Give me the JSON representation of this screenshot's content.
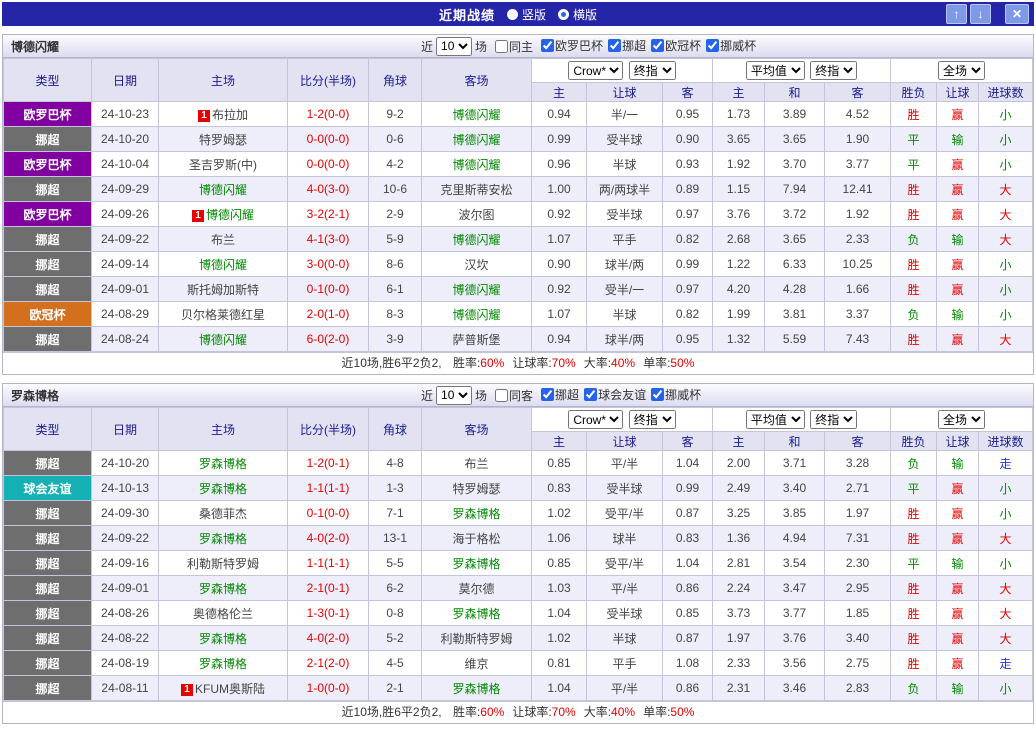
{
  "colors": {
    "red": "#e60000",
    "green": "#008800",
    "blue": "#2233cc",
    "score": "#e60000",
    "subject_team": "#008800",
    "league": {
      "欧罗巴杯": "#8000a0",
      "挪超": "#6e6e6e",
      "欧冠杯": "#d2701e",
      "球会友谊": "#14b0b4"
    }
  },
  "result_colors": {
    "胜": "red",
    "平": "green",
    "负": "green",
    "赢": "red",
    "输": "green",
    "走": "blue",
    "大": "red",
    "小": "green"
  },
  "title_bar": {
    "title": "近期战绩",
    "radios": [
      {
        "label": "竖版",
        "selected": false
      },
      {
        "label": "横版",
        "selected": true
      }
    ],
    "buttons": {
      "up": "↑",
      "down": "↓",
      "close": "✕"
    }
  },
  "table_header": {
    "type": "类型",
    "date": "日期",
    "home": "主场",
    "score": "比分(半场)",
    "corner": "角球",
    "away": "客场",
    "asia_selects": [
      "Crow*",
      "终指"
    ],
    "europe_selects": [
      "平均值",
      "终指"
    ],
    "result_select": "全场",
    "asia_sub": [
      "主",
      "让球",
      "客"
    ],
    "europe_sub": [
      "主",
      "和",
      "客"
    ],
    "result_sub": [
      "胜负",
      "让球",
      "进球数"
    ]
  },
  "sections": [
    {
      "team": "博德闪耀",
      "filter": {
        "near": "近",
        "count": "10",
        "games": "场",
        "same": "同主",
        "same_checked": false,
        "leagues": [
          {
            "label": "欧罗巴杯",
            "checked": true
          },
          {
            "label": "挪超",
            "checked": true
          },
          {
            "label": "欧冠杯",
            "checked": true
          },
          {
            "label": "挪威杯",
            "checked": true
          }
        ]
      },
      "rows": [
        {
          "league": "欧罗巴杯",
          "date": "24-10-23",
          "home": "布拉加",
          "home_badge": "1",
          "score": "1-2(0-0)",
          "corner": "9-2",
          "away": "博德闪耀",
          "asia": [
            "0.94",
            "半/一",
            "0.95"
          ],
          "europe": [
            "1.73",
            "3.89",
            "4.52"
          ],
          "results": [
            "胜",
            "赢",
            "小"
          ]
        },
        {
          "league": "挪超",
          "date": "24-10-20",
          "home": "特罗姆瑟",
          "score": "0-0(0-0)",
          "corner": "0-6",
          "away": "博德闪耀",
          "asia": [
            "0.99",
            "受半球",
            "0.90"
          ],
          "europe": [
            "3.65",
            "3.65",
            "1.90"
          ],
          "results": [
            "平",
            "输",
            "小"
          ]
        },
        {
          "league": "欧罗巴杯",
          "date": "24-10-04",
          "home": "圣吉罗斯(中)",
          "score": "0-0(0-0)",
          "corner": "4-2",
          "away": "博德闪耀",
          "asia": [
            "0.96",
            "半球",
            "0.93"
          ],
          "europe": [
            "1.92",
            "3.70",
            "3.77"
          ],
          "results": [
            "平",
            "赢",
            "小"
          ]
        },
        {
          "league": "挪超",
          "date": "24-09-29",
          "home": "博德闪耀",
          "score": "4-0(3-0)",
          "corner": "10-6",
          "away": "克里斯蒂安松",
          "asia": [
            "1.00",
            "两/两球半",
            "0.89"
          ],
          "europe": [
            "1.15",
            "7.94",
            "12.41"
          ],
          "results": [
            "胜",
            "赢",
            "大"
          ]
        },
        {
          "league": "欧罗巴杯",
          "date": "24-09-26",
          "home": "博德闪耀",
          "home_badge": "1",
          "score": "3-2(2-1)",
          "corner": "2-9",
          "away": "波尔图",
          "asia": [
            "0.92",
            "受半球",
            "0.97"
          ],
          "europe": [
            "3.76",
            "3.72",
            "1.92"
          ],
          "results": [
            "胜",
            "赢",
            "大"
          ]
        },
        {
          "league": "挪超",
          "date": "24-09-22",
          "home": "布兰",
          "score": "4-1(3-0)",
          "corner": "5-9",
          "away": "博德闪耀",
          "asia": [
            "1.07",
            "平手",
            "0.82"
          ],
          "europe": [
            "2.68",
            "3.65",
            "2.33"
          ],
          "results": [
            "负",
            "输",
            "大"
          ]
        },
        {
          "league": "挪超",
          "date": "24-09-14",
          "home": "博德闪耀",
          "score": "3-0(0-0)",
          "corner": "8-6",
          "away": "汉坎",
          "asia": [
            "0.90",
            "球半/两",
            "0.99"
          ],
          "europe": [
            "1.22",
            "6.33",
            "10.25"
          ],
          "results": [
            "胜",
            "赢",
            "小"
          ]
        },
        {
          "league": "挪超",
          "date": "24-09-01",
          "home": "斯托姆加斯特",
          "score": "0-1(0-0)",
          "corner": "6-1",
          "away": "博德闪耀",
          "asia": [
            "0.92",
            "受半/一",
            "0.97"
          ],
          "europe": [
            "4.20",
            "4.28",
            "1.66"
          ],
          "results": [
            "胜",
            "赢",
            "小"
          ]
        },
        {
          "league": "欧冠杯",
          "date": "24-08-29",
          "home": "贝尔格莱德红星",
          "score": "2-0(1-0)",
          "corner": "8-3",
          "away": "博德闪耀",
          "asia": [
            "1.07",
            "半球",
            "0.82"
          ],
          "europe": [
            "1.99",
            "3.81",
            "3.37"
          ],
          "results": [
            "负",
            "输",
            "小"
          ]
        },
        {
          "league": "挪超",
          "date": "24-08-24",
          "home": "博德闪耀",
          "score": "6-0(2-0)",
          "corner": "3-9",
          "away": "萨普斯堡",
          "asia": [
            "0.94",
            "球半/两",
            "0.95"
          ],
          "europe": [
            "1.32",
            "5.59",
            "7.43"
          ],
          "results": [
            "胜",
            "赢",
            "大"
          ]
        }
      ],
      "footer": {
        "summary": "近10场,胜6平2负2,",
        "stats": [
          {
            "label": "胜率:",
            "value": "60%"
          },
          {
            "label": "让球率:",
            "value": "70%"
          },
          {
            "label": "大率:",
            "value": "40%"
          },
          {
            "label": "单率:",
            "value": "50%"
          }
        ]
      }
    },
    {
      "team": "罗森博格",
      "filter": {
        "near": "近",
        "count": "10",
        "games": "场",
        "same": "同客",
        "same_checked": false,
        "leagues": [
          {
            "label": "挪超",
            "checked": true
          },
          {
            "label": "球会友谊",
            "checked": true
          },
          {
            "label": "挪威杯",
            "checked": true
          }
        ]
      },
      "rows": [
        {
          "league": "挪超",
          "date": "24-10-20",
          "home": "罗森博格",
          "score": "1-2(0-1)",
          "corner": "4-8",
          "away": "布兰",
          "asia": [
            "0.85",
            "平/半",
            "1.04"
          ],
          "europe": [
            "2.00",
            "3.71",
            "3.28"
          ],
          "results": [
            "负",
            "输",
            "走"
          ]
        },
        {
          "league": "球会友谊",
          "date": "24-10-13",
          "home": "罗森博格",
          "score": "1-1(1-1)",
          "corner": "1-3",
          "away": "特罗姆瑟",
          "asia": [
            "0.83",
            "受半球",
            "0.99"
          ],
          "europe": [
            "2.49",
            "3.40",
            "2.71"
          ],
          "results": [
            "平",
            "赢",
            "小"
          ]
        },
        {
          "league": "挪超",
          "date": "24-09-30",
          "home": "桑德菲杰",
          "score": "0-1(0-0)",
          "corner": "7-1",
          "away": "罗森博格",
          "asia": [
            "1.02",
            "受平/半",
            "0.87"
          ],
          "europe": [
            "3.25",
            "3.85",
            "1.97"
          ],
          "results": [
            "胜",
            "赢",
            "小"
          ]
        },
        {
          "league": "挪超",
          "date": "24-09-22",
          "home": "罗森博格",
          "score": "4-0(2-0)",
          "corner": "13-1",
          "away": "海于格松",
          "asia": [
            "1.06",
            "球半",
            "0.83"
          ],
          "europe": [
            "1.36",
            "4.94",
            "7.31"
          ],
          "results": [
            "胜",
            "赢",
            "大"
          ]
        },
        {
          "league": "挪超",
          "date": "24-09-16",
          "home": "利勒斯特罗姆",
          "score": "1-1(1-1)",
          "corner": "5-5",
          "away": "罗森博格",
          "asia": [
            "0.85",
            "受平/半",
            "1.04"
          ],
          "europe": [
            "2.81",
            "3.54",
            "2.30"
          ],
          "results": [
            "平",
            "输",
            "小"
          ]
        },
        {
          "league": "挪超",
          "date": "24-09-01",
          "home": "罗森博格",
          "score": "2-1(0-1)",
          "corner": "6-2",
          "away": "莫尔德",
          "asia": [
            "1.03",
            "平/半",
            "0.86"
          ],
          "europe": [
            "2.24",
            "3.47",
            "2.95"
          ],
          "results": [
            "胜",
            "赢",
            "大"
          ]
        },
        {
          "league": "挪超",
          "date": "24-08-26",
          "home": "奥德格伦兰",
          "score": "1-3(0-1)",
          "corner": "0-8",
          "away": "罗森博格",
          "asia": [
            "1.04",
            "受半球",
            "0.85"
          ],
          "europe": [
            "3.73",
            "3.77",
            "1.85"
          ],
          "results": [
            "胜",
            "赢",
            "大"
          ]
        },
        {
          "league": "挪超",
          "date": "24-08-22",
          "home": "罗森博格",
          "score": "4-0(2-0)",
          "corner": "5-2",
          "away": "利勒斯特罗姆",
          "asia": [
            "1.02",
            "半球",
            "0.87"
          ],
          "europe": [
            "1.97",
            "3.76",
            "3.40"
          ],
          "results": [
            "胜",
            "赢",
            "大"
          ]
        },
        {
          "league": "挪超",
          "date": "24-08-19",
          "home": "罗森博格",
          "score": "2-1(2-0)",
          "corner": "4-5",
          "away": "维京",
          "asia": [
            "0.81",
            "平手",
            "1.08"
          ],
          "europe": [
            "2.33",
            "3.56",
            "2.75"
          ],
          "results": [
            "胜",
            "赢",
            "走"
          ]
        },
        {
          "league": "挪超",
          "date": "24-08-11",
          "home": "KFUM奥斯陆",
          "home_badge": "1",
          "score": "1-0(0-0)",
          "corner": "2-1",
          "away": "罗森博格",
          "asia": [
            "1.04",
            "平/半",
            "0.86"
          ],
          "europe": [
            "2.31",
            "3.46",
            "2.83"
          ],
          "results": [
            "负",
            "输",
            "小"
          ]
        }
      ],
      "footer": {
        "summary": "近10场,胜6平2负2,",
        "stats": [
          {
            "label": "胜率:",
            "value": "60%"
          },
          {
            "label": "让球率:",
            "value": "70%"
          },
          {
            "label": "大率:",
            "value": "40%"
          },
          {
            "label": "单率:",
            "value": "50%"
          }
        ]
      }
    }
  ]
}
